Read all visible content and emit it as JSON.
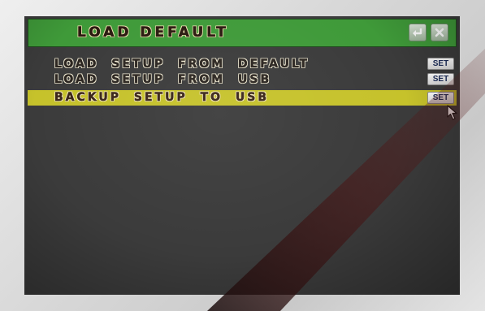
{
  "dialog": {
    "title": "LOAD DEFAULT",
    "enter_icon": "enter-return-icon",
    "close_icon": "close-icon"
  },
  "menu": {
    "items": [
      {
        "label": "LOAD SETUP FROM DEFAULT",
        "button": "SET",
        "selected": false
      },
      {
        "label": "LOAD SETUP FROM USB",
        "button": "SET",
        "selected": false
      },
      {
        "label": "BACKUP SETUP TO USB",
        "button": "SET",
        "selected": true
      }
    ]
  },
  "colors": {
    "titlebar": "#3f9a39",
    "highlight": "#c6c22b",
    "panel": "#3b3b3b"
  }
}
